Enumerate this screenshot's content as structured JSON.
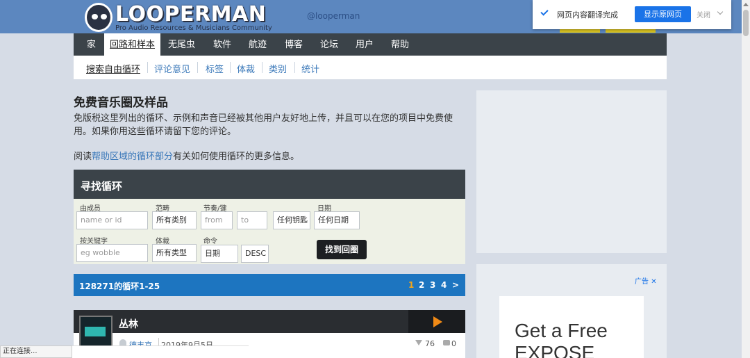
{
  "header": {
    "logo_text": "LOOPERMAN",
    "tagline": "Pro Audio Resources & Musicians Community",
    "handle": "@looperman"
  },
  "translate_popup": {
    "status": "网页内容翻译完成",
    "show_original": "显示原网页",
    "close": "关闭"
  },
  "nav": {
    "items": [
      "家",
      "回路和样本",
      "无尾虫",
      "软件",
      "航迹",
      "博客",
      "论坛",
      "用户",
      "帮助"
    ]
  },
  "subnav": {
    "items": [
      "搜索自由循环",
      "评论意见",
      "标签",
      "体裁",
      "类别",
      "统计"
    ]
  },
  "main": {
    "title": "免费音乐圈及样品",
    "intro": "免版税这里列出的循环、示例和声音已经被其他用户友好地上传，并且可以在您的项目中免费使用。如果你用这些循环请留下您的评论。",
    "read_prefix": "阅读",
    "read_link": "帮助区域的循环部分",
    "read_suffix": "有关如何使用循环的更多信息。"
  },
  "search": {
    "title": "寻找循环",
    "labels": {
      "member": "由成员",
      "category": "范畴",
      "tempo_key": "节奏/键",
      "date": "日期",
      "keyword": "按关键字",
      "genre": "体裁",
      "order": "命令"
    },
    "fields": {
      "member_placeholder": "name or id",
      "category": "所有类别",
      "tempo_from": "from",
      "tempo_to": "to",
      "key": "任何钥匙",
      "date": "任何日期",
      "keyword_placeholder": "eg wobble",
      "genre": "所有类型",
      "order_by": "日期",
      "order_dir": "DESC"
    },
    "button": "找到回圈"
  },
  "results": {
    "summary": "128271的循环1-25",
    "pages": [
      "1",
      "2",
      "3",
      "4",
      ">"
    ]
  },
  "loop": {
    "title": "丛林",
    "user": "德丰京",
    "date": "2019年9月5日",
    "downloads": "76",
    "comments": "0"
  },
  "ad": {
    "label": "广告",
    "headline": "Get a Free",
    "headline2": "EXPOSE"
  },
  "status_bar": "正在连接..."
}
